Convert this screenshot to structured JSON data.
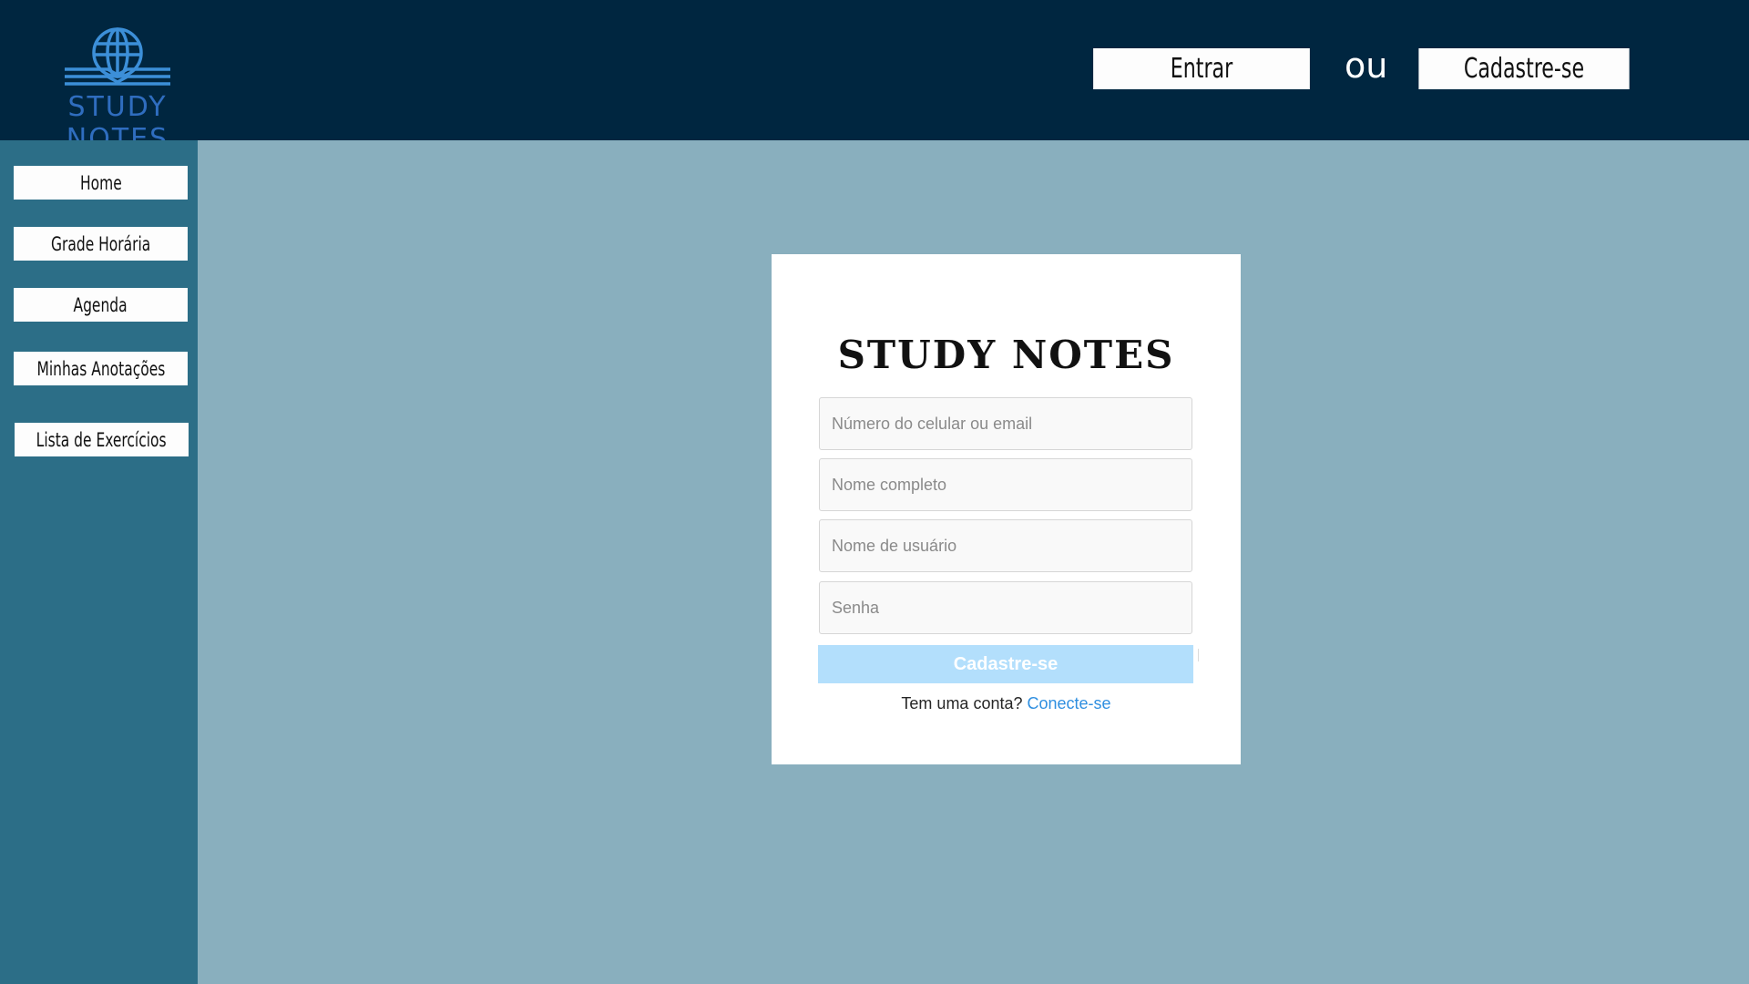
{
  "header": {
    "logo_text": "STUDY NOTES",
    "login_label": "Entrar",
    "or_label": "ou",
    "signup_label": "Cadastre-se"
  },
  "sidebar": {
    "items": [
      {
        "label": "Home"
      },
      {
        "label": "Grade Horária"
      },
      {
        "label": "Agenda"
      },
      {
        "label": "Minhas Anotações"
      },
      {
        "label": "Lista de Exercícios"
      }
    ]
  },
  "form": {
    "brand": "STUDY NOTES",
    "phone_email_placeholder": "Número do celular ou email",
    "full_name_placeholder": "Nome completo",
    "username_placeholder": "Nome de usuário",
    "password_placeholder": "Senha",
    "submit_label": "Cadastre-se",
    "have_account_text": "Tem uma conta?",
    "login_link": "Conecte-se"
  },
  "colors": {
    "header_bg": "#002640",
    "sidebar_bg": "#2c6e87",
    "main_bg": "#89afbe",
    "logo_blue": "#2f6dbf",
    "submit_bg": "#b3dffc",
    "link_blue": "#2f8fe0"
  },
  "icons": {
    "logo": "globe-book-icon"
  }
}
